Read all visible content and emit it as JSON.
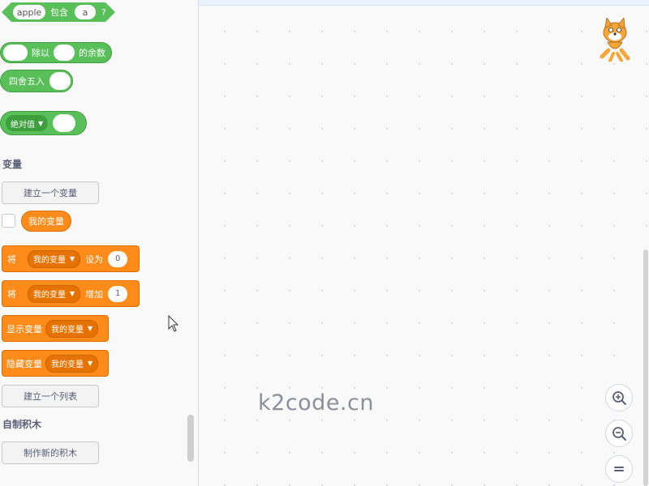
{
  "operators": {
    "contains": {
      "left": "apple",
      "label": "包含",
      "right": "a",
      "suffix": "?"
    },
    "mod": {
      "label": "除以",
      "suffix": "的余数"
    },
    "round": {
      "label": "四舍五入"
    },
    "abs": {
      "dropdown": "绝对值"
    }
  },
  "variables": {
    "title": "变量",
    "make_button": "建立一个变量",
    "my_variable": "我的变量",
    "set_block": {
      "prefix": "将",
      "variable": "我的变量",
      "verb": "设为",
      "value": "0"
    },
    "change_block": {
      "prefix": "将",
      "variable": "我的变量",
      "verb": "增加",
      "value": "1"
    },
    "show_block": {
      "label": "显示变量",
      "variable": "我的变量"
    },
    "hide_block": {
      "label": "隐藏变量",
      "variable": "我的变量"
    },
    "make_list_button": "建立一个列表"
  },
  "my_blocks": {
    "title": "自制积木",
    "make_button": "制作新的积木"
  },
  "workspace": {
    "watermark": "k2code.cn",
    "zoom_in_icon": "zoom-in-icon",
    "zoom_out_icon": "zoom-out-icon",
    "reset_icon": "reset-zoom-icon"
  },
  "colors": {
    "operators": "#59c059",
    "variables": "#ff8c1a",
    "palette_bg": "#f9f9f9"
  }
}
